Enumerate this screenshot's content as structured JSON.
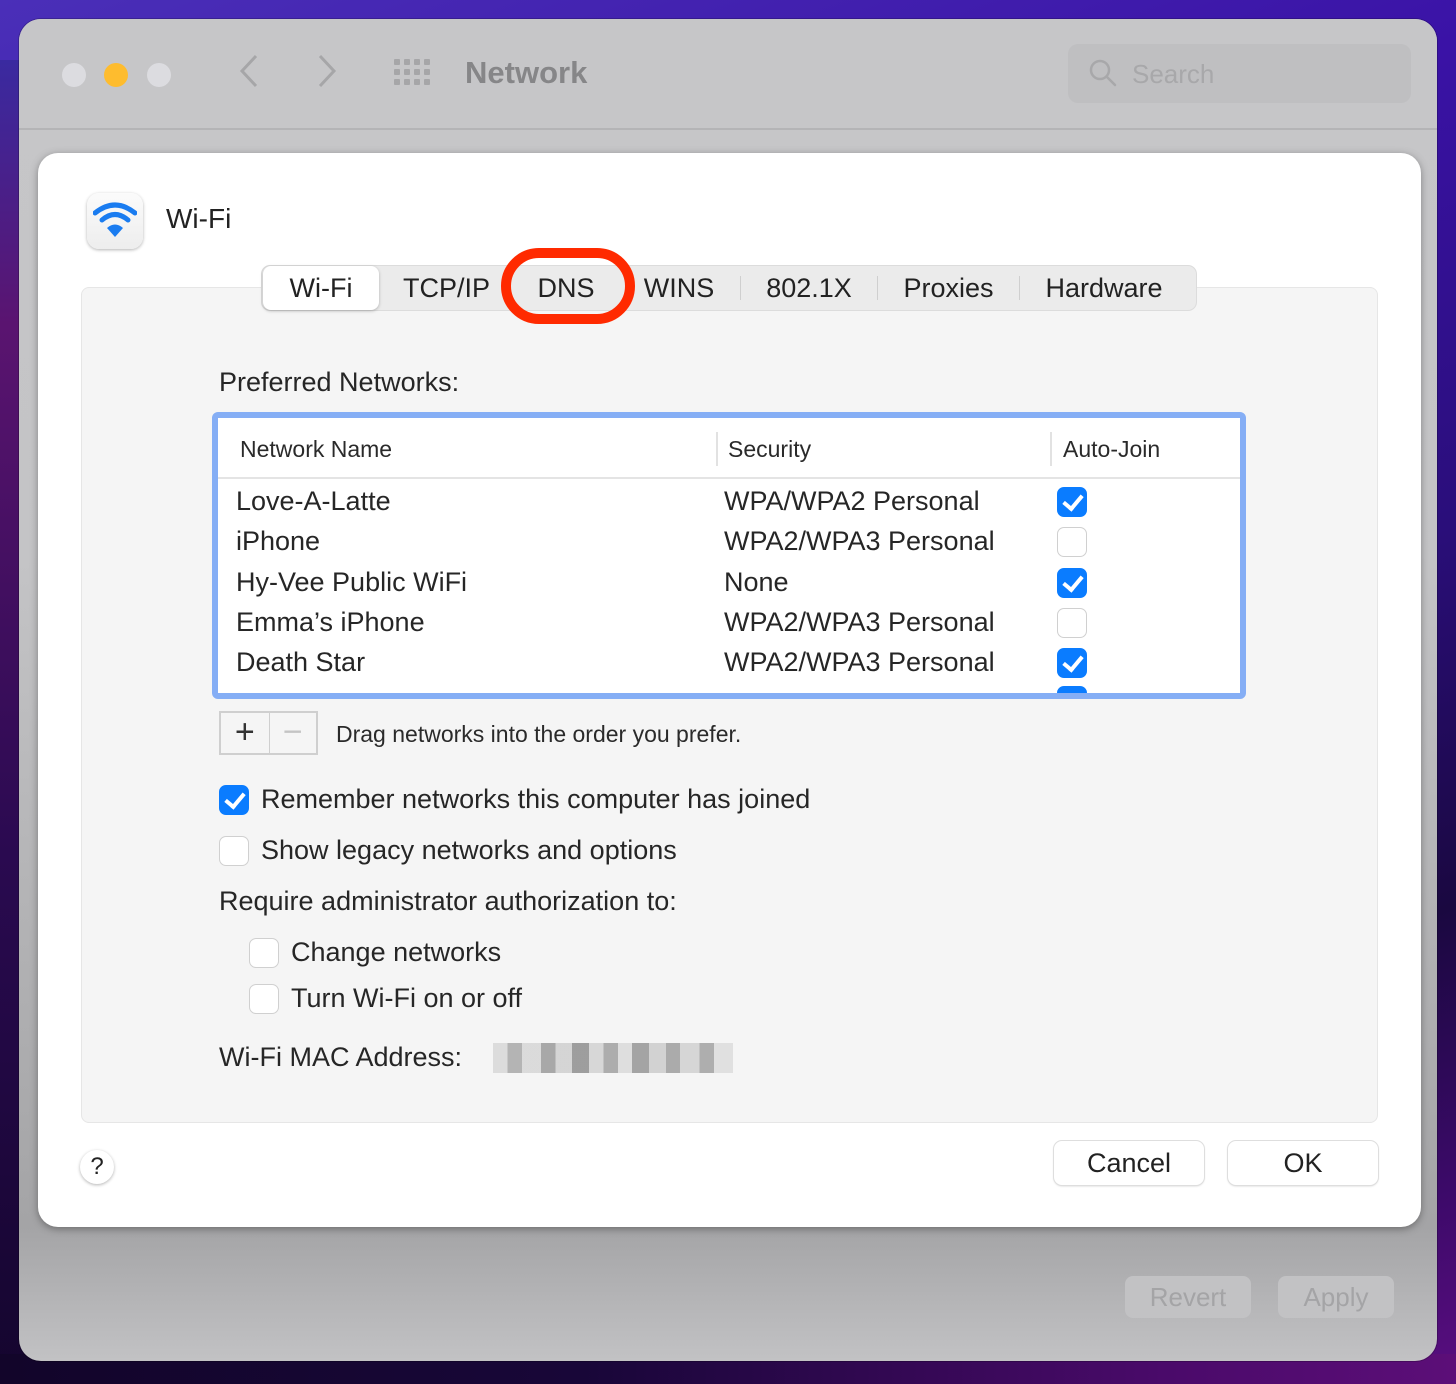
{
  "window": {
    "title": "Network",
    "search_placeholder": "Search",
    "revert_label": "Revert",
    "apply_label": "Apply",
    "icons": {
      "close": "traffic-light-close",
      "minimize": "traffic-light-minimize",
      "zoom": "traffic-light-zoom",
      "back": "chevron-left-icon",
      "forward": "chevron-right-icon",
      "show_all": "grid-icon",
      "search": "search-icon"
    }
  },
  "sheet": {
    "title": "Wi-Fi",
    "icon": "wifi-icon",
    "tabs": [
      {
        "label": "Wi-Fi",
        "active": true
      },
      {
        "label": "TCP/IP",
        "active": false
      },
      {
        "label": "DNS",
        "active": false,
        "highlighted": true
      },
      {
        "label": "WINS",
        "active": false
      },
      {
        "label": "802.1X",
        "active": false
      },
      {
        "label": "Proxies",
        "active": false
      },
      {
        "label": "Hardware",
        "active": false
      }
    ],
    "highlight_color": "#ff2a00",
    "preferred_networks": {
      "label": "Preferred Networks:",
      "columns": [
        "Network Name",
        "Security",
        "Auto-Join"
      ],
      "rows": [
        {
          "name": "Love-A-Latte",
          "security": "WPA/WPA2 Personal",
          "auto_join": true
        },
        {
          "name": "iPhone",
          "security": "WPA2/WPA3 Personal",
          "auto_join": false
        },
        {
          "name": "Hy-Vee Public WiFi",
          "security": "None",
          "auto_join": true
        },
        {
          "name": "Emma’s iPhone",
          "security": "WPA2/WPA3 Personal",
          "auto_join": false
        },
        {
          "name": "Death Star",
          "security": "WPA2/WPA3 Personal",
          "auto_join": true
        }
      ],
      "add_label": "+",
      "remove_label": "−",
      "drag_hint": "Drag networks into the order you prefer."
    },
    "options": {
      "remember_networks": {
        "label": "Remember networks this computer has joined",
        "checked": true
      },
      "show_legacy": {
        "label": "Show legacy networks and options",
        "checked": false
      }
    },
    "admin": {
      "label": "Require administrator authorization to:",
      "change_networks": {
        "label": "Change networks",
        "checked": false
      },
      "turn_wifi": {
        "label": "Turn Wi-Fi on or off",
        "checked": false
      }
    },
    "mac_address_label": "Wi-Fi MAC Address:",
    "help_label": "?",
    "cancel_label": "Cancel",
    "ok_label": "OK"
  },
  "colors": {
    "accent": "#0a7cff",
    "table_focus_ring": "#85aef5",
    "minimize_yellow": "#febc2e"
  }
}
